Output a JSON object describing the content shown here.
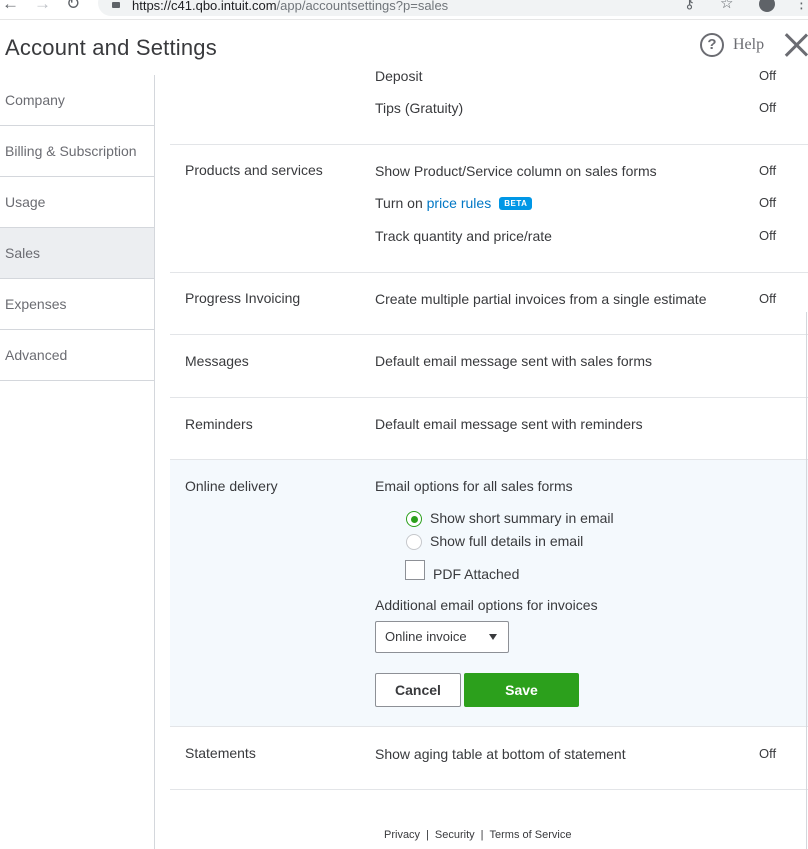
{
  "browser": {
    "url_host": "https://c41.qbo.intuit.com",
    "url_path": "/app/accountsettings?p=sales"
  },
  "header": {
    "title": "Account and Settings",
    "help_label": "Help"
  },
  "sidebar": {
    "items": [
      {
        "label": "Company"
      },
      {
        "label": "Billing & Subscription"
      },
      {
        "label": "Usage"
      },
      {
        "label": "Sales",
        "active": true
      },
      {
        "label": "Expenses"
      },
      {
        "label": "Advanced"
      }
    ]
  },
  "sections": {
    "top_partial": {
      "rows": [
        {
          "label": "Deposit",
          "value": "Off"
        },
        {
          "label": "Tips (Gratuity)",
          "value": "Off"
        }
      ]
    },
    "products": {
      "title": "Products and services",
      "row1_label": "Show Product/Service column on sales forms",
      "row1_value": "Off",
      "row2_prefix": "Turn on",
      "row2_link": "price rules",
      "row2_badge": "BETA",
      "row2_value": "Off",
      "row3_label": "Track quantity and price/rate",
      "row3_value": "Off"
    },
    "progress": {
      "title": "Progress Invoicing",
      "row_label": "Create multiple partial invoices from a single estimate",
      "row_value": "Off"
    },
    "messages": {
      "title": "Messages",
      "row_label": "Default email message sent with sales forms"
    },
    "reminders": {
      "title": "Reminders",
      "row_label": "Default email message sent with reminders"
    },
    "delivery": {
      "title": "Online delivery",
      "email_options_label": "Email options for all sales forms",
      "radio_summary": "Show short summary in email",
      "radio_full": "Show full details in email",
      "selected_radio": "summary",
      "pdf_attached": "PDF Attached",
      "pdf_checked": false,
      "additional_label": "Additional email options for invoices",
      "invoice_option": "Online invoice",
      "cancel_label": "Cancel",
      "save_label": "Save"
    },
    "statements": {
      "title": "Statements",
      "row_label": "Show aging table at bottom of statement",
      "row_value": "Off"
    }
  },
  "footer": {
    "privacy": "Privacy",
    "security": "Security",
    "terms": "Terms of Service",
    "separator": "|"
  },
  "colors": {
    "accent_green": "#2ca01c",
    "link_blue": "#0077c5",
    "beta_blue": "#0097e6",
    "delivery_bg": "#f4f9fd"
  }
}
